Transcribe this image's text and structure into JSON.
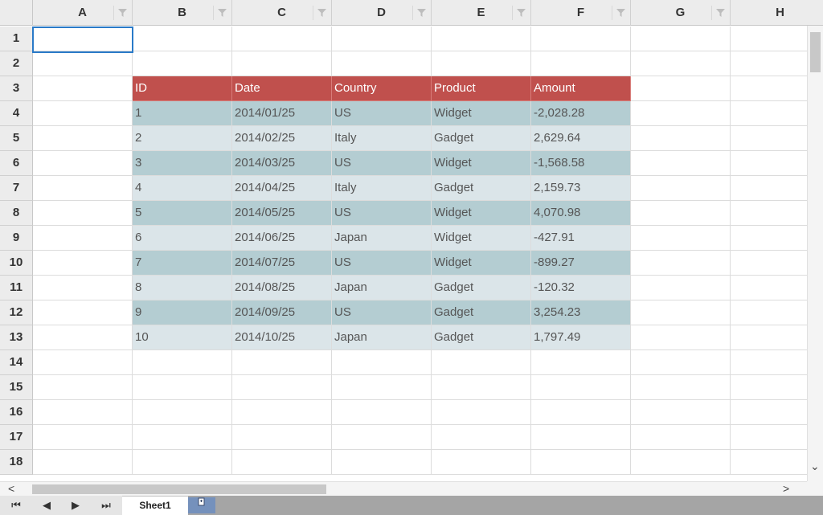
{
  "columns": [
    "A",
    "B",
    "C",
    "D",
    "E",
    "F",
    "G",
    "H"
  ],
  "rows": [
    "1",
    "2",
    "3",
    "4",
    "5",
    "6",
    "7",
    "8",
    "9",
    "10",
    "11",
    "12",
    "13",
    "14",
    "15",
    "16",
    "17",
    "18"
  ],
  "table": {
    "headers": [
      "ID",
      "Date",
      "Country",
      "Product",
      "Amount"
    ],
    "rows": [
      [
        "1",
        "2014/01/25",
        "US",
        "Widget",
        "-2,028.28"
      ],
      [
        "2",
        "2014/02/25",
        "Italy",
        "Gadget",
        "2,629.64"
      ],
      [
        "3",
        "2014/03/25",
        "US",
        "Widget",
        "-1,568.58"
      ],
      [
        "4",
        "2014/04/25",
        "Italy",
        "Gadget",
        "2,159.73"
      ],
      [
        "5",
        "2014/05/25",
        "US",
        "Widget",
        "4,070.98"
      ],
      [
        "6",
        "2014/06/25",
        "Japan",
        "Widget",
        "-427.91"
      ],
      [
        "7",
        "2014/07/25",
        "US",
        "Widget",
        "-899.27"
      ],
      [
        "8",
        "2014/08/25",
        "Japan",
        "Gadget",
        "-120.32"
      ],
      [
        "9",
        "2014/09/25",
        "US",
        "Gadget",
        "3,254.23"
      ],
      [
        "10",
        "2014/10/25",
        "Japan",
        "Gadget",
        "1,797.49"
      ]
    ],
    "header_color": "#c0504d",
    "band_colors": [
      "#b4cdd2",
      "#dbe5e9"
    ]
  },
  "scrollbars": {
    "left_arrow": "<",
    "right_arrow": ">",
    "down_arrow": "⌄"
  },
  "tabs": {
    "nav": [
      "⏮",
      "◀",
      "▶",
      "⏭"
    ],
    "sheet_label": "Sheet1",
    "add_icon": "add-sheet-icon"
  },
  "selected_cell": "A1",
  "accent_color": "#2a7ac8"
}
